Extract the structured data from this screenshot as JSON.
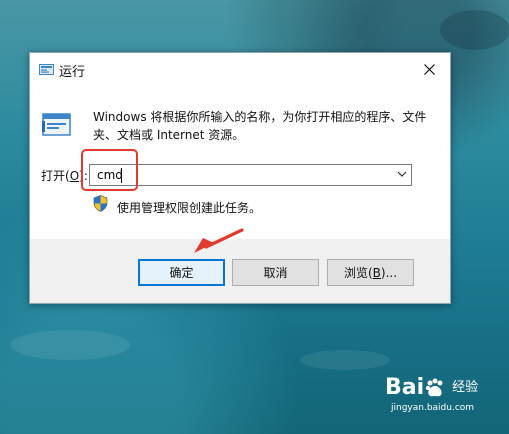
{
  "dialog": {
    "title": "运行",
    "description": "Windows 将根据你所输入的名称，为你打开相应的程序、文件夹、文档或 Internet 资源。",
    "open_label_prefix": "打开(",
    "open_label_mnemonic": "O",
    "open_label_suffix": "):",
    "input_value": "cmd",
    "admin_note": "使用管理权限创建此任务。",
    "buttons": {
      "ok": "确定",
      "cancel": "取消",
      "browse_prefix": "浏览(",
      "browse_mnemonic": "B",
      "browse_suffix": ")..."
    }
  },
  "watermark": {
    "brand_prefix": "Bai",
    "brand_suffix": "经验",
    "url": "jingyan.baidu.com"
  },
  "colors": {
    "annotation_red": "#e23a2e",
    "primary_button_border": "#0078d7",
    "icon_blue": "#3c86c8"
  },
  "icons": [
    "run-app-icon",
    "close-icon",
    "run-program-icon",
    "dropdown-chevron-icon",
    "uac-shield-icon",
    "annotation-arrow",
    "baidu-paw-icon"
  ]
}
